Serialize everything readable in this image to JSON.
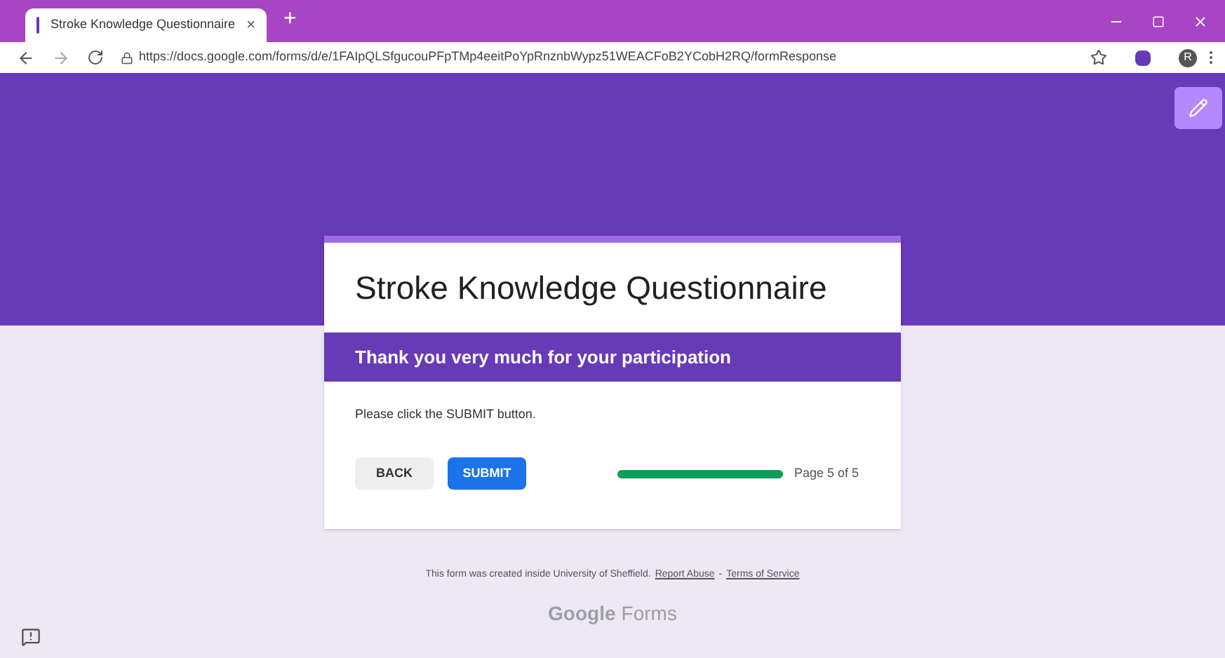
{
  "browser": {
    "tab": {
      "title": "Stroke Knowledge Questionnaire",
      "close": "×"
    },
    "new_tab": "+",
    "url": "https://docs.google.com/forms/d/e/1FAIpQLSfgucouPFpTMp4eeitPoYpRnznbWypz51WEACFoB2YCobH2RQ/formResponse",
    "avatar_letter": "R"
  },
  "form": {
    "title": "Stroke Knowledge Questionnaire",
    "section_title": "Thank you very much for your participation",
    "instruction": "Please click the SUBMIT button.",
    "buttons": [
      {
        "label": "BACK",
        "kind": "secondary"
      },
      {
        "label": "SUBMIT",
        "kind": "primary"
      }
    ],
    "progress": {
      "level": 1,
      "label": "Page 5 of 5"
    }
  },
  "footer": {
    "text": "This form was created inside University of Sheffield.",
    "links": [
      "Report Abuse",
      "Terms of Service"
    ],
    "separator": "-",
    "brand": "Google",
    "product": "Forms"
  }
}
